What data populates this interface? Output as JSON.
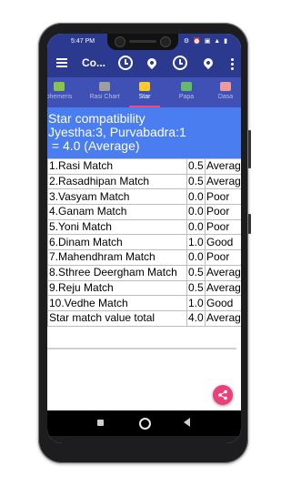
{
  "status": {
    "time": "5:47 PM",
    "right_icons": "⚙ ⏰ ▣ ▲ ▮"
  },
  "appbar": {
    "title": "Co..."
  },
  "tabs": [
    {
      "label": "phemeris",
      "color": "#8bc34a"
    },
    {
      "label": "Rasi Chart",
      "color": "#9e9e9e"
    },
    {
      "label": "Star",
      "color": "#ffca28"
    },
    {
      "label": "Papa",
      "color": "#66bb6a"
    },
    {
      "label": "Dasa",
      "color": "#ef9a9a"
    }
  ],
  "header": {
    "line1": "Star compatibility",
    "line2": "Jyestha:3, Purvabadra:1",
    "line3": " = 4.0 (Average)"
  },
  "rows": [
    {
      "name": "1.Rasi Match",
      "value": "0.5",
      "result": "Average"
    },
    {
      "name": "2.Rasadhipan Match",
      "value": "0.5",
      "result": "Average"
    },
    {
      "name": "3.Vasyam Match",
      "value": "0.0",
      "result": "Poor"
    },
    {
      "name": "4.Ganam Match",
      "value": "0.0",
      "result": "Poor"
    },
    {
      "name": "5.Yoni Match",
      "value": "0.0",
      "result": "Poor"
    },
    {
      "name": "6.Dinam Match",
      "value": "1.0",
      "result": "Good"
    },
    {
      "name": "7.Mahendhram Match",
      "value": "0.0",
      "result": "Poor"
    },
    {
      "name": "8.Sthree Deergham Match",
      "value": "0.5",
      "result": "Average"
    },
    {
      "name": "9.Reju Match",
      "value": "0.5",
      "result": "Average"
    },
    {
      "name": "10.Vedhe Match",
      "value": "1.0",
      "result": "Good"
    },
    {
      "name": "Star match value total",
      "value": "4.0",
      "result": "Average"
    }
  ],
  "colors": {
    "appbar": "#2b3a8f",
    "tabs": "#3f51b5",
    "header": "#4a7df0",
    "fab": "#ec407a",
    "tab_indicator": "#ff4081"
  }
}
